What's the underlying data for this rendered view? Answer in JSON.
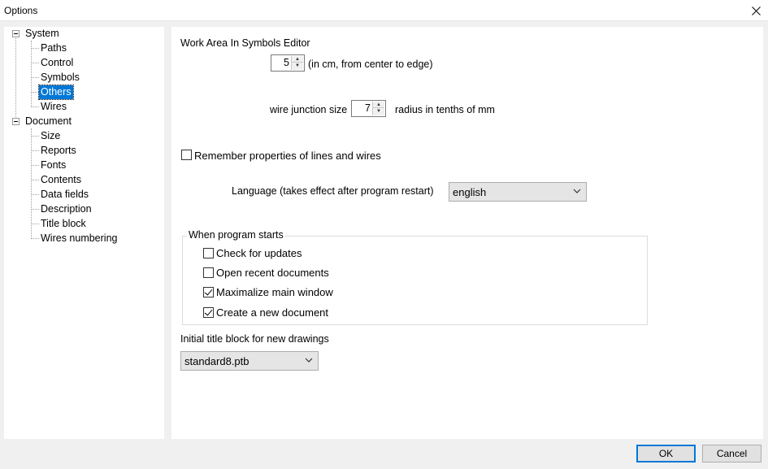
{
  "window": {
    "title": "Options"
  },
  "tree": {
    "system": {
      "label": "System",
      "children": [
        "Paths",
        "Control",
        "Symbols",
        "Others",
        "Wires"
      ]
    },
    "document": {
      "label": "Document",
      "children": [
        "Size",
        "Reports",
        "Fonts",
        "Contents",
        "Data fields",
        "Description",
        "Title block",
        "Wires numbering"
      ]
    },
    "selected": "Others"
  },
  "panel": {
    "work_area": {
      "heading": "Work Area In Symbols Editor",
      "value": "5",
      "unit_label": "(in cm, from center to edge)"
    },
    "junction": {
      "label": "wire junction size",
      "value": "7",
      "unit_label": "radius in tenths of mm"
    },
    "remember": {
      "label": "Remember properties of lines and wires",
      "checked": false
    },
    "language": {
      "label": "Language (takes effect after program restart)",
      "value": "english"
    },
    "startup": {
      "legend": "When program starts",
      "options": [
        {
          "label": "Check for updates",
          "checked": false
        },
        {
          "label": "Open recent documents",
          "checked": false
        },
        {
          "label": "Maximalize main window",
          "checked": true
        },
        {
          "label": "Create a new document",
          "checked": true
        }
      ]
    },
    "title_block": {
      "label": "Initial title block for new drawings",
      "value": "standard8.ptb"
    }
  },
  "buttons": {
    "ok": "OK",
    "cancel": "Cancel"
  },
  "icons": {
    "close": "close-icon",
    "chevron": "chevron-down-icon",
    "collapse": "tree-collapse-icon"
  }
}
